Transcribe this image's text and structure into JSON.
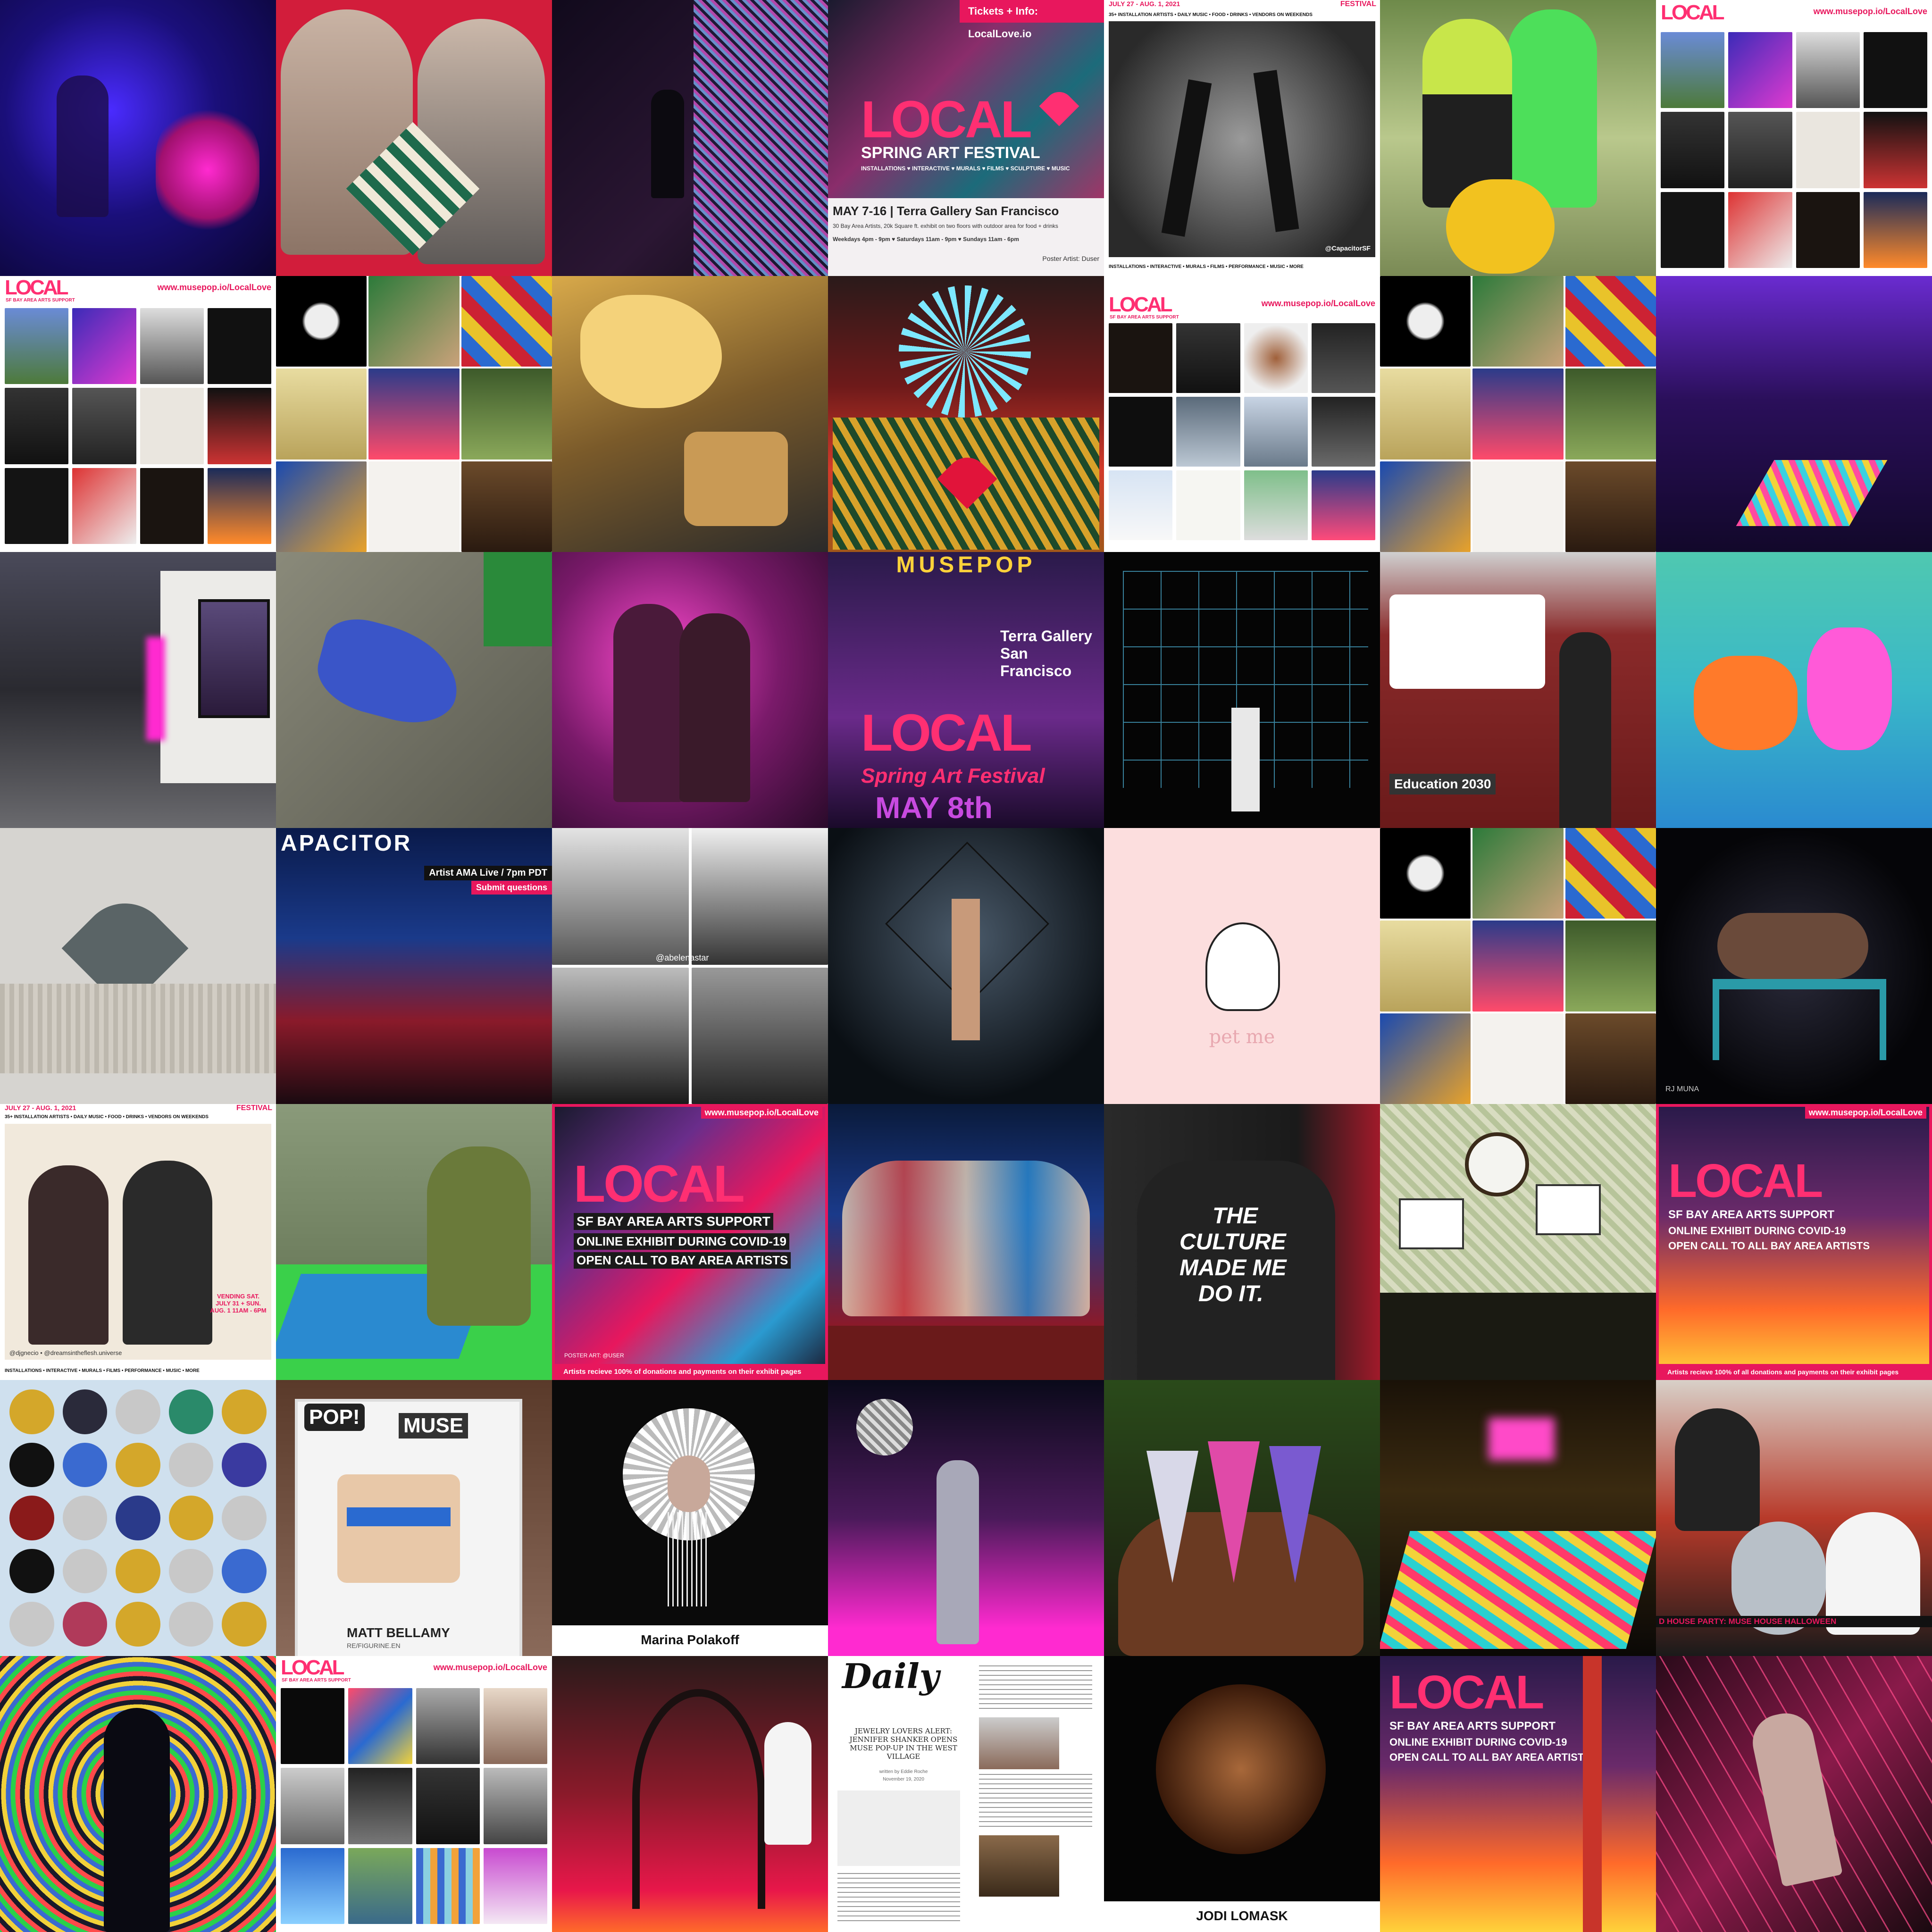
{
  "colors": {
    "brand_pink": "#ff2f72",
    "banner_pink": "#e8175d",
    "dark": "#111111"
  },
  "tiles": {
    "r0c3": {
      "top_banner": "Tickets + Info: LocalLove.io",
      "logo": "LOCAL",
      "title": "SPRING ART FESTIVAL",
      "subtitle": "INSTALLATIONS ♥ INTERACTIVE ♥ MURALS ♥ FILMS ♥ SCULPTURE ♥ MUSIC",
      "dates": "MAY 7-16 | Terra Gallery San Francisco",
      "desc": "30 Bay Area Artists, 20k Square ft. exhibit on two floors with outdoor area for food + drinks",
      "hours": "Weekdays 4pm - 9pm  ♥  Saturdays 11am - 9pm  ♥  Sundays 11am - 6pm",
      "credit": "Poster Artist: Duser"
    },
    "r0c4": {
      "top": "JULY 27 - AUG. 1, 2021",
      "top_right": "FESTIVAL",
      "line": "35+ INSTALLATION ARTISTS • DAILY MUSIC • FOOD • DRINKS • VENDORS ON WEEKENDS",
      "handle": "@CapacitorSF",
      "footer": "INSTALLATIONS • INTERACTIVE • MURALS • FILMS • PERFORMANCE • MUSIC • MORE"
    },
    "r0c6": {
      "url": "www.musepop.io/LocalLove",
      "logo": "LOCAL"
    },
    "r1c0": {
      "url": "www.musepop.io/LocalLove",
      "logo": "LOCAL",
      "tagline": "SF BAY AREA ARTS SUPPORT"
    },
    "r1c4": {
      "url": "www.musepop.io/LocalLove",
      "logo": "LOCAL",
      "tagline": "SF BAY AREA ARTS SUPPORT"
    },
    "r2c3": {
      "top": "MUSEPOP",
      "venue": "Terra Gallery San Francisco",
      "logo": "LOCAL",
      "title": "Spring Art Festival",
      "date": "MAY 8th"
    },
    "r2c5": {
      "sign": "Education 2030"
    },
    "r3c1": {
      "title": "APACITOR",
      "badge": "Artist AMA Live / 7pm PDT",
      "sub": "Submit questions"
    },
    "r3c2": {
      "handle": "@abelenastar"
    },
    "r3c4": {
      "caption": "pet me"
    },
    "r3c6": {
      "credit": "RJ MUNA"
    },
    "r4c0": {
      "top": "JULY 27 - AUG. 1, 2021",
      "top_right": "FESTIVAL",
      "line": "35+ INSTALLATION ARTISTS • DAILY MUSIC • FOOD • DRINKS • VENDORS ON WEEKENDS",
      "vending": "VENDING SAT. JULY 31 + SUN. AUG. 1 11AM - 6PM",
      "handles": "@djgnecio • @dreamsintheflesh.universe",
      "footer": "INSTALLATIONS • INTERACTIVE • MURALS • FILMS • PERFORMANCE • MUSIC • MORE"
    },
    "r4c2": {
      "url": "www.musepop.io/LocalLove",
      "logo": "LOCAL",
      "l1": "SF BAY AREA ARTS SUPPORT",
      "l2": "ONLINE EXHIBIT DURING COVID-19",
      "l3": "OPEN CALL TO BAY AREA ARTISTS",
      "credit": "POSTER ART: @USER",
      "footer": "Artists recieve 100% of donations and payments on their exhibit pages"
    },
    "r4c4": {
      "l1": "THE",
      "l2": "CULTURE",
      "l3": "MADE ME",
      "l4": "DO IT."
    },
    "r4c6": {
      "url": "www.musepop.io/LocalLove",
      "logo": "LOCAL",
      "l1": "SF BAY AREA ARTS SUPPORT",
      "l2": "ONLINE EXHIBIT DURING COVID-19",
      "l3": "OPEN CALL TO ALL BAY AREA ARTISTS",
      "footer": "Artists recieve 100% of all donations and payments on their exhibit pages"
    },
    "r5c1": {
      "brand": "POP!",
      "box": "MUSE",
      "name": "MATT BELLAMY",
      "sub": "RE/FIGURINE.EN"
    },
    "r5c2": {
      "caption": "Marina Polakoff"
    },
    "r5c6": {
      "banner": "D HOUSE PARTY: MUSE HOUSE HALLOWEEN"
    },
    "r6c1": {
      "url": "www.musepop.io/LocalLove",
      "logo": "LOCAL",
      "tagline": "SF BAY AREA ARTS SUPPORT"
    },
    "r6c3": {
      "masthead": "Daily",
      "headline": "JEWELRY LOVERS ALERT: JENNIFER SHANKER OPENS MUSE POP-UP IN THE WEST VILLAGE",
      "byline": "written by Eddie Roche",
      "date": "November 19, 2020"
    },
    "r6c4": {
      "caption": "JODI LOMASK"
    },
    "r6c5": {
      "logo": "LOCAL",
      "l1": "SF BAY AREA ARTS SUPPORT",
      "l2": "ONLINE EXHIBIT DURING COVID-19",
      "l3": "OPEN CALL TO ALL BAY AREA ARTISTS"
    }
  }
}
